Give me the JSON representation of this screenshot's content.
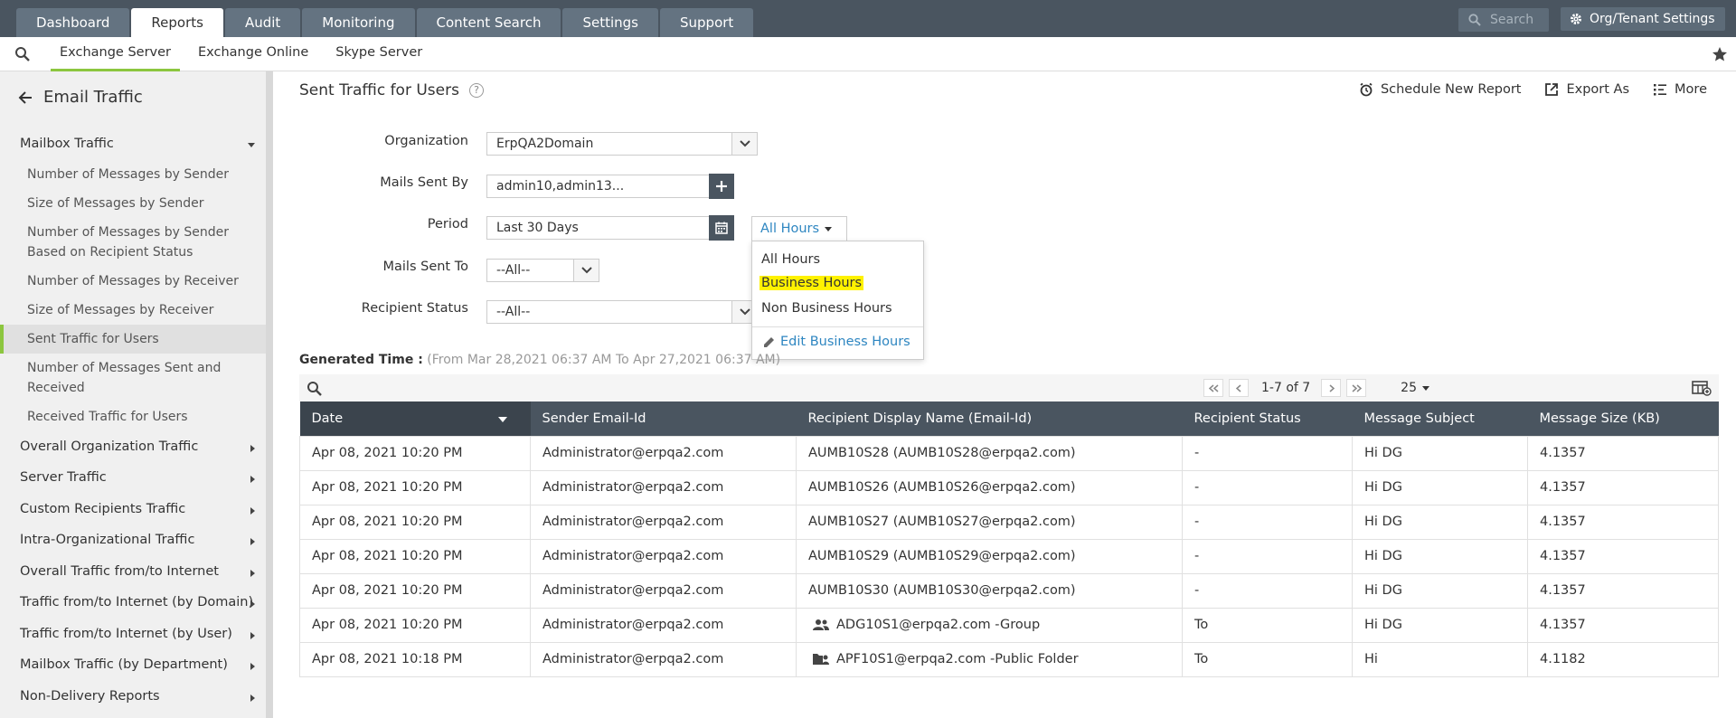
{
  "top_nav": {
    "tabs": [
      {
        "label": "Dashboard",
        "active": false
      },
      {
        "label": "Reports",
        "active": true
      },
      {
        "label": "Audit",
        "active": false
      },
      {
        "label": "Monitoring",
        "active": false
      },
      {
        "label": "Content Search",
        "active": false
      },
      {
        "label": "Settings",
        "active": false
      },
      {
        "label": "Support",
        "active": false
      }
    ],
    "search_placeholder": "Search",
    "org_settings_label": "Org/Tenant Settings"
  },
  "sub_nav": {
    "tabs": [
      {
        "label": "Exchange Server",
        "active": true
      },
      {
        "label": "Exchange Online",
        "active": false
      },
      {
        "label": "Skype Server",
        "active": false
      }
    ]
  },
  "sidebar": {
    "title": "Email Traffic",
    "mailbox_traffic": "Mailbox Traffic",
    "sub_items": [
      "Number of Messages by Sender",
      "Size of Messages by Sender",
      "Number of Messages by Sender Based on Recipient Status",
      "Number of Messages by Receiver",
      "Size of Messages by Receiver",
      "Sent Traffic for Users",
      "Number of Messages Sent and Received",
      "Received Traffic for Users"
    ],
    "categories": [
      "Overall Organization Traffic",
      "Server Traffic",
      "Custom Recipients Traffic",
      "Intra-Organizational Traffic",
      "Overall Traffic from/to Internet",
      "Traffic from/to Internet (by Domain)",
      "Traffic from/to Internet (by User)",
      "Mailbox Traffic (by Department)",
      "Non-Delivery Reports"
    ]
  },
  "main": {
    "title": "Sent Traffic for Users",
    "actions": {
      "schedule": "Schedule New Report",
      "export": "Export As",
      "more": "More"
    },
    "form": {
      "organization_label": "Organization",
      "organization_value": "ErpQA2Domain",
      "mails_sent_by_label": "Mails Sent By",
      "mails_sent_by_value": "admin10,admin13...",
      "period_label": "Period",
      "period_value": "Last 30 Days",
      "hours_value": "All Hours",
      "mails_sent_to_label": "Mails Sent To",
      "mails_sent_to_value": "--All--",
      "recipient_status_label": "Recipient Status",
      "recipient_status_value": "--All--"
    },
    "hours_dropdown": {
      "options": [
        "All Hours",
        "Business Hours",
        "Non Business Hours"
      ],
      "highlighted": "Business Hours",
      "edit_label": "Edit Business Hours"
    },
    "generated_time_label": "Generated Time :",
    "generated_time_value": "(From Mar 28,2021 06:37 AM To Apr 27,2021 06:37 AM)",
    "pager": {
      "range": "1-7 of 7",
      "page_size": "25"
    },
    "table": {
      "columns": [
        "Date",
        "Sender Email-Id",
        "Recipient Display Name (Email-Id)",
        "Recipient Status",
        "Message Subject",
        "Message Size (KB)"
      ],
      "rows": [
        {
          "date": "Apr 08, 2021 10:20 PM",
          "sender": "Administrator@erpqa2.com",
          "recipient": "AUMB10S28 (AUMB10S28@erpqa2.com)",
          "icon": "",
          "status": "-",
          "subject": "Hi DG",
          "size": "4.1357"
        },
        {
          "date": "Apr 08, 2021 10:20 PM",
          "sender": "Administrator@erpqa2.com",
          "recipient": "AUMB10S26 (AUMB10S26@erpqa2.com)",
          "icon": "",
          "status": "-",
          "subject": "Hi DG",
          "size": "4.1357"
        },
        {
          "date": "Apr 08, 2021 10:20 PM",
          "sender": "Administrator@erpqa2.com",
          "recipient": "AUMB10S27 (AUMB10S27@erpqa2.com)",
          "icon": "",
          "status": "-",
          "subject": "Hi DG",
          "size": "4.1357"
        },
        {
          "date": "Apr 08, 2021 10:20 PM",
          "sender": "Administrator@erpqa2.com",
          "recipient": "AUMB10S29 (AUMB10S29@erpqa2.com)",
          "icon": "",
          "status": "-",
          "subject": "Hi DG",
          "size": "4.1357"
        },
        {
          "date": "Apr 08, 2021 10:20 PM",
          "sender": "Administrator@erpqa2.com",
          "recipient": "AUMB10S30 (AUMB10S30@erpqa2.com)",
          "icon": "",
          "status": "-",
          "subject": "Hi DG",
          "size": "4.1357"
        },
        {
          "date": "Apr 08, 2021 10:20 PM",
          "sender": "Administrator@erpqa2.com",
          "recipient": "ADG10S1@erpqa2.com -Group",
          "icon": "group-icon",
          "status": "To",
          "subject": "Hi DG",
          "size": "4.1357"
        },
        {
          "date": "Apr 08, 2021 10:18 PM",
          "sender": "Administrator@erpqa2.com",
          "recipient": "APF10S1@erpqa2.com -Public Folder",
          "icon": "public-folder-icon",
          "status": "To",
          "subject": "Hi",
          "size": "4.1182"
        }
      ]
    }
  },
  "colors": {
    "topbar": "#4a5560",
    "accent_green": "#8cc63f",
    "link_blue": "#2e86c1",
    "highlight": "#fff200"
  }
}
